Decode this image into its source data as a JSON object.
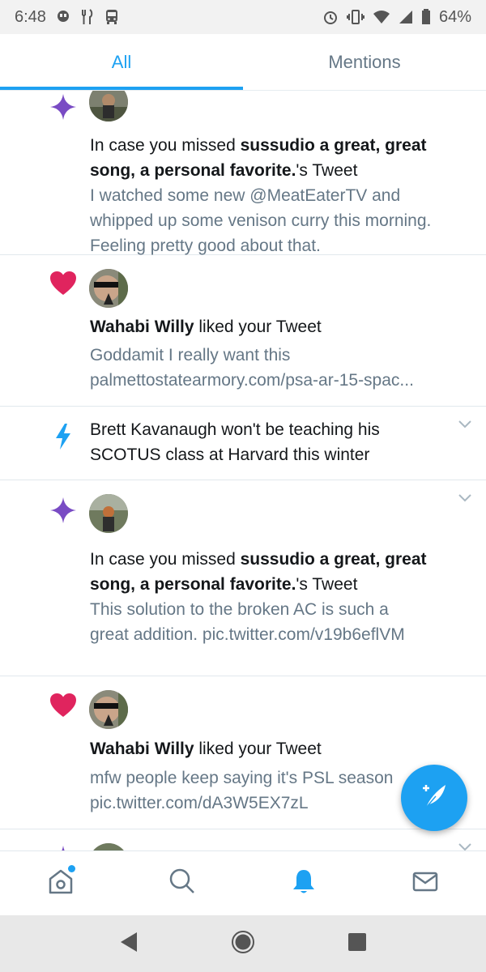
{
  "status_bar": {
    "time": "6:48",
    "battery": "64%",
    "icons_left": [
      "hangouts-icon",
      "restaurant-icon",
      "bus-icon"
    ],
    "icons_right": [
      "alarm-icon",
      "vibrate-icon",
      "wifi-icon",
      "signal-icon",
      "battery-icon"
    ]
  },
  "tabs": [
    {
      "label": "All",
      "active": true
    },
    {
      "label": "Mentions",
      "active": false
    }
  ],
  "feed": [
    {
      "type": "missed",
      "icon": "sparkle-icon",
      "prefix": "In case you missed ",
      "bold": "sussudio a great, great song, a personal favorite.",
      "suffix": "'s Tweet",
      "body": "I watched some new @MeatEaterTV and whipped up some venison curry this morning. Feeling pretty good about that."
    },
    {
      "type": "like",
      "icon": "heart-icon",
      "name": "Wahabi Willy",
      "action": " liked your Tweet",
      "body_line1": "Goddamit I really want this",
      "body_line2": "palmettostatearmory.com/psa-ar-15-spac..."
    },
    {
      "type": "news",
      "icon": "lightning-icon",
      "text": "Brett Kavanaugh won't be teaching his SCOTUS class at Harvard this winter"
    },
    {
      "type": "missed",
      "icon": "sparkle-icon",
      "prefix": "In case you missed ",
      "bold": "sussudio a great, great song, a personal favorite.",
      "suffix": "'s Tweet",
      "body": "This solution to the broken AC is such a great addition. pic.twitter.com/v19b6eflVM"
    },
    {
      "type": "like",
      "icon": "heart-icon",
      "name": "Wahabi Willy",
      "action": " liked your Tweet",
      "body_line1": "mfw people keep saying it's PSL season",
      "body_line2": "pic.twitter.com/dA3W5EX7zL"
    }
  ],
  "bottom_nav": [
    "home-icon",
    "search-icon",
    "notifications-icon",
    "messages-icon"
  ],
  "colors": {
    "accent": "#1da1f2",
    "heart": "#e0245e",
    "sparkle": "#794bc4",
    "muted": "#657786"
  }
}
